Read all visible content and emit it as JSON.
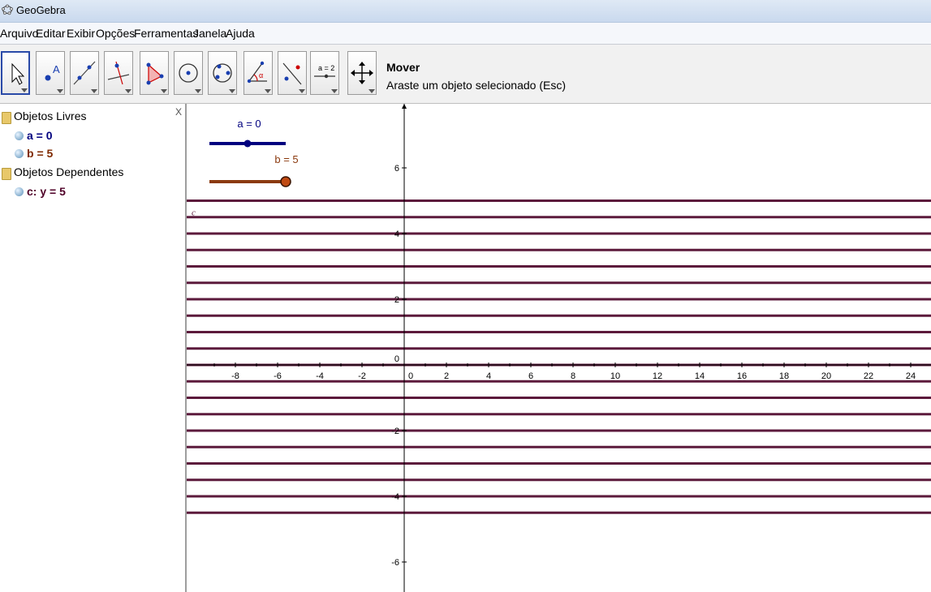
{
  "window": {
    "title": "GeoGebra"
  },
  "menu": [
    "Arquivo",
    "Editar",
    "Exibir",
    "Opções",
    "Ferramentas",
    "Janela",
    "Ajuda"
  ],
  "toolbar": {
    "tools": [
      {
        "icon": "move-arrow-icon"
      },
      {
        "icon": "new-point-icon"
      },
      {
        "icon": "line-through-points-icon"
      },
      {
        "icon": "perpendicular-line-icon"
      },
      {
        "icon": "polygon-icon"
      },
      {
        "icon": "circle-center-point-icon"
      },
      {
        "icon": "circle-three-points-icon"
      },
      {
        "icon": "angle-icon"
      },
      {
        "icon": "reflect-object-icon"
      },
      {
        "icon": "slider-icon",
        "label": "a = 2"
      },
      {
        "icon": "move-graphics-icon"
      }
    ],
    "selected_tool_name": "Mover",
    "selected_tool_desc": "Araste um objeto selecionado (Esc)"
  },
  "algebra": {
    "close": "X",
    "free_header": "Objetos Livres",
    "free_items": [
      {
        "text": "a = 0",
        "color": "#00007f"
      },
      {
        "text": "b = 5",
        "color": "#7f2a00"
      }
    ],
    "dependent_header": "Objetos Dependentes",
    "dependent_items": [
      {
        "text": "c: y = 5",
        "color": "#4f0027"
      }
    ]
  },
  "graphics": {
    "slider_a_label": "a = 0",
    "slider_a_value": 0,
    "slider_a_color": "#00007f",
    "slider_b_label": "b = 5",
    "slider_b_value": 5,
    "slider_b_color": "#8b3a0f",
    "line_label": "c",
    "line_color": "#5c1a3c",
    "x_ticks": [
      "-8",
      "-6",
      "-4",
      "-2",
      "0",
      "2",
      "4",
      "6",
      "8",
      "10",
      "12",
      "14",
      "16",
      "18",
      "20",
      "22",
      "24"
    ],
    "y_ticks": [
      "6",
      "4",
      "2",
      "0",
      "-2",
      "-4",
      "-6"
    ],
    "trace_y_values": [
      5,
      4.5,
      4,
      3.5,
      3,
      2.5,
      2,
      1.5,
      1,
      0.5,
      0,
      -0.5,
      -1,
      -1.5,
      -2,
      -2.5,
      -3,
      -3.5,
      -4,
      -4.5
    ]
  }
}
